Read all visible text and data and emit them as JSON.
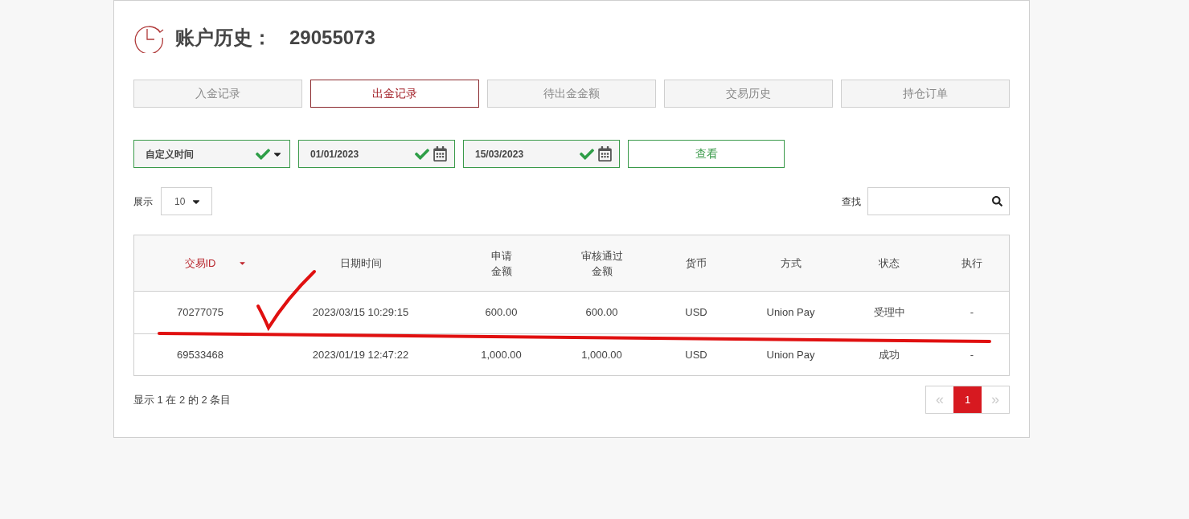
{
  "header": {
    "title": "账户历史：",
    "account": "29055073"
  },
  "tabs": [
    {
      "label": "入金记录",
      "selected": false
    },
    {
      "label": "出金记录",
      "selected": true
    },
    {
      "label": "待出金金额",
      "selected": false
    },
    {
      "label": "交易历史",
      "selected": false
    },
    {
      "label": "持仓订单",
      "selected": false
    }
  ],
  "filters": [
    {
      "kind": "select",
      "value": "自定义时间",
      "valid": true
    },
    {
      "kind": "date",
      "value": "01/01/2023",
      "valid": true
    },
    {
      "kind": "date",
      "value": "15/03/2023",
      "valid": true
    }
  ],
  "view_button": "查看",
  "page_size": {
    "label": "展示",
    "value": "10"
  },
  "search": {
    "label": "查找"
  },
  "table": {
    "columns": [
      {
        "label": "交易ID",
        "sorted": true
      },
      {
        "label": "日期时间",
        "sorted": false
      },
      {
        "label": "申请金额",
        "sorted": false
      },
      {
        "label": "审核通过金额",
        "sorted": false
      },
      {
        "label": "货币",
        "sorted": false
      },
      {
        "label": "方式",
        "sorted": false
      },
      {
        "label": "状态",
        "sorted": false
      },
      {
        "label": "执行",
        "sorted": false
      }
    ],
    "rows": [
      [
        "70277075",
        "2023/03/15 10:29:15",
        "600.00",
        "600.00",
        "USD",
        "Union Pay",
        "受理中",
        "-"
      ],
      [
        "69533468",
        "2023/01/19 12:47:22",
        "1,000.00",
        "1,000.00",
        "USD",
        "Union Pay",
        "成功",
        "-"
      ]
    ]
  },
  "summary": "显示 1 在 2 的 2 条目",
  "pagination": {
    "prev": {
      "label": "«",
      "disabled": true
    },
    "pages": [
      {
        "label": "1",
        "selected": true
      }
    ],
    "next": {
      "label": "»",
      "disabled": true
    }
  }
}
